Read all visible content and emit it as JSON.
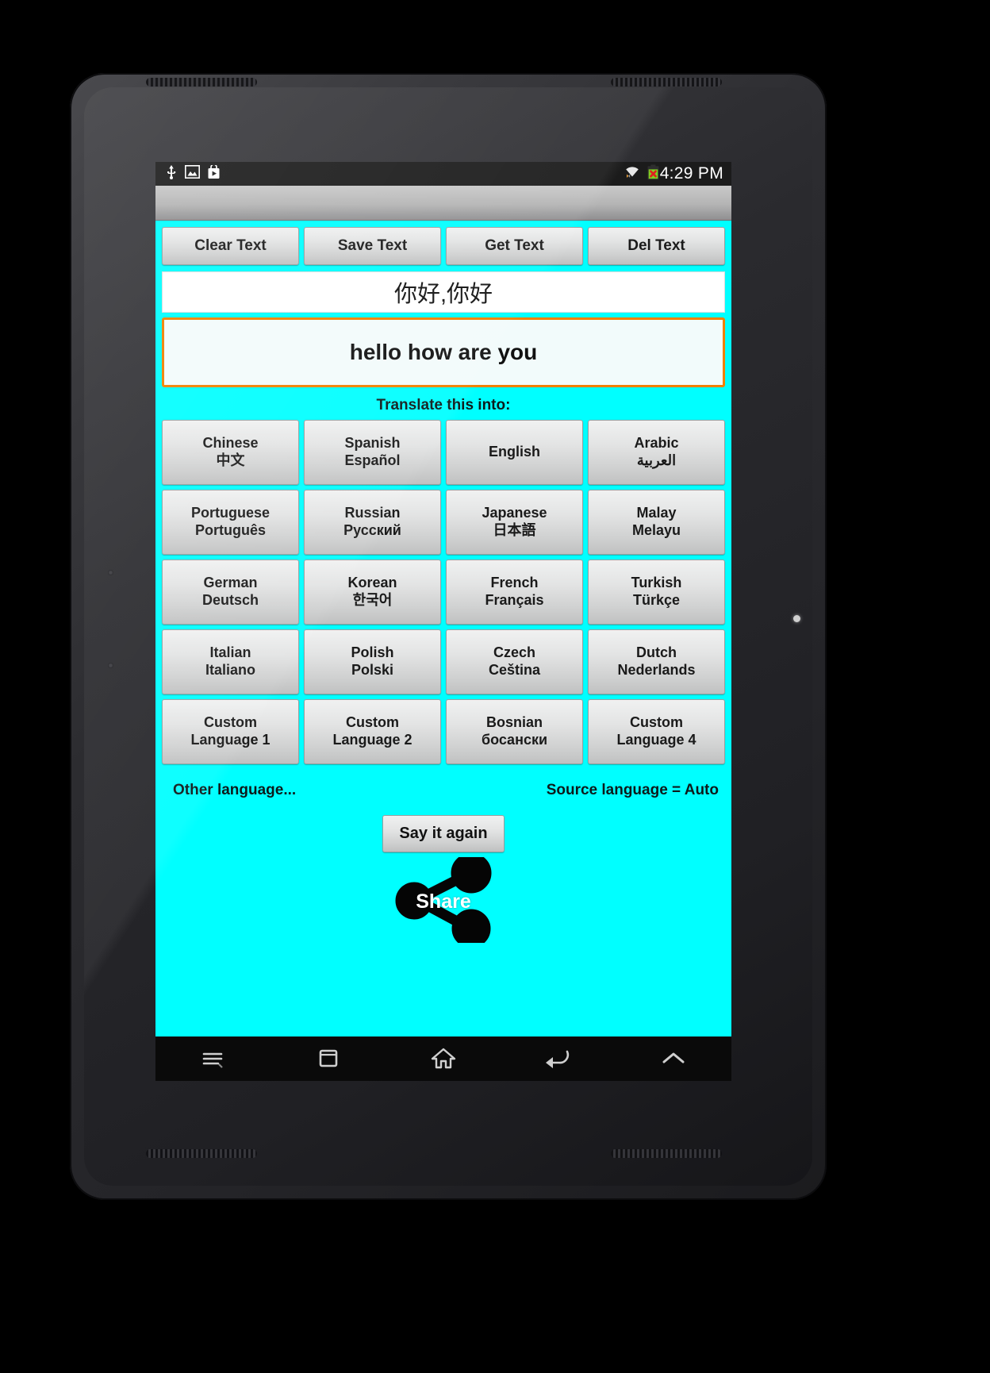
{
  "device": {
    "type": "android-tablet"
  },
  "status_bar": {
    "time": "4:29 PM",
    "left_icons": [
      "usb-icon",
      "image-icon",
      "app-install-icon"
    ],
    "right_icons": [
      "wifi-icon",
      "battery-error-icon"
    ]
  },
  "toolbar": {
    "buttons": [
      {
        "label": "Clear Text",
        "name": "clear-text-button"
      },
      {
        "label": "Save Text",
        "name": "save-text-button"
      },
      {
        "label": "Get Text",
        "name": "get-text-button"
      },
      {
        "label": "Del Text",
        "name": "del-text-button"
      }
    ]
  },
  "fields": {
    "output_text": "你好,你好",
    "input_text": "hello how are you",
    "input_border_color": "#F08000"
  },
  "translate": {
    "heading": "Translate this into:",
    "languages": [
      {
        "line1": "Chinese",
        "line2": "中文"
      },
      {
        "line1": "Spanish",
        "line2": "Español"
      },
      {
        "line1": "English",
        "line2": ""
      },
      {
        "line1": "Arabic",
        "line2": "العربية"
      },
      {
        "line1": "Portuguese",
        "line2": "Português"
      },
      {
        "line1": "Russian",
        "line2": "Русский"
      },
      {
        "line1": "Japanese",
        "line2": "日本語"
      },
      {
        "line1": "Malay",
        "line2": "Melayu"
      },
      {
        "line1": "German",
        "line2": "Deutsch"
      },
      {
        "line1": "Korean",
        "line2": "한국어"
      },
      {
        "line1": "French",
        "line2": "Français"
      },
      {
        "line1": "Turkish",
        "line2": "Türkçe"
      },
      {
        "line1": "Italian",
        "line2": "Italiano"
      },
      {
        "line1": "Polish",
        "line2": "Polski"
      },
      {
        "line1": "Czech",
        "line2": "Ceština"
      },
      {
        "line1": "Dutch",
        "line2": "Nederlands"
      },
      {
        "line1": "Custom",
        "line2": "Language 1"
      },
      {
        "line1": "Custom",
        "line2": "Language 2"
      },
      {
        "line1": "Bosnian",
        "line2": "босански"
      },
      {
        "line1": "Custom",
        "line2": "Language 4"
      }
    ]
  },
  "footer": {
    "other_language": "Other language...",
    "source_language": "Source language = Auto",
    "say_again": "Say it again",
    "share": "Share"
  },
  "navbar": {
    "items": [
      "menu-icon",
      "recents-icon",
      "home-icon",
      "back-icon",
      "expand-up-icon"
    ]
  },
  "colors": {
    "app_background": "#00FFFF",
    "accent_orange": "#F08000",
    "status_bar": "#1b1b1b"
  }
}
